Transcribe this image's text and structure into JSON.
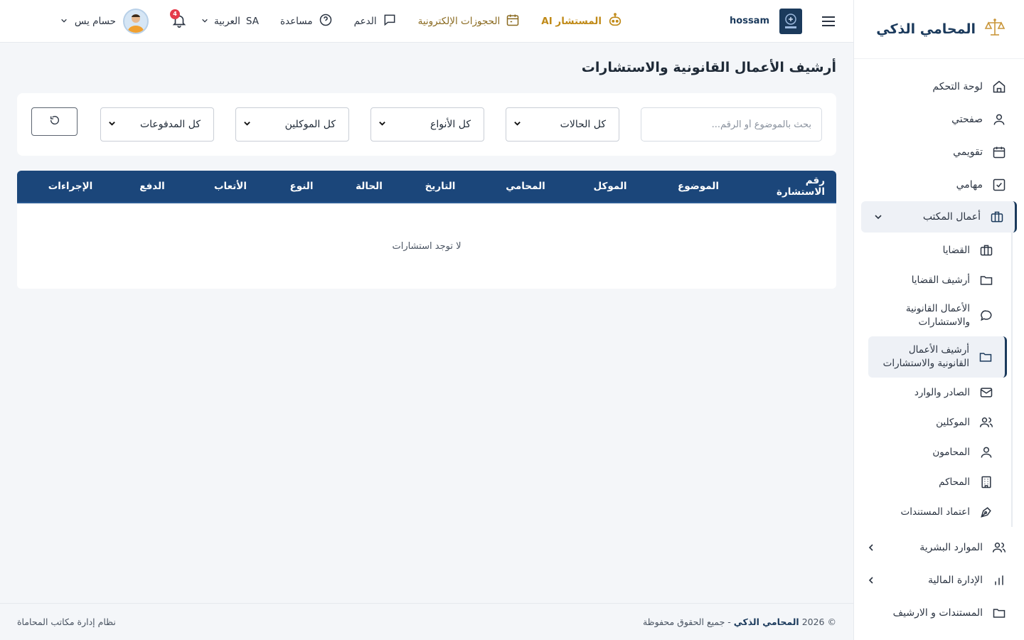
{
  "brand": {
    "name": "المحامي الذكي"
  },
  "topbar": {
    "username": "hossam",
    "ai_label": "المستشار AI",
    "booking_label": "الحجوزات الإلكترونية",
    "support_label": "الدعم",
    "help_label": "مساعدة",
    "lang_code": "SA",
    "lang_label": "العربية",
    "notification_count": "4",
    "profile_name": "حسام يس"
  },
  "sidebar": {
    "items": [
      {
        "label": "لوحة التحكم",
        "icon": "home-icon"
      },
      {
        "label": "صفحتي",
        "icon": "user-icon"
      },
      {
        "label": "تقويمي",
        "icon": "calendar-icon"
      },
      {
        "label": "مهامي",
        "icon": "checkbox-icon"
      }
    ],
    "office": {
      "label": "أعمال المكتب",
      "sub": [
        {
          "label": "القضايا"
        },
        {
          "label": "أرشيف القضايا"
        },
        {
          "label": "الأعمال القانونية والاستشارات"
        },
        {
          "label": "أرشيف الأعمال القانونية والاستشارات"
        },
        {
          "label": "الصادر والوارد"
        },
        {
          "label": "الموكلين"
        },
        {
          "label": "المحامون"
        },
        {
          "label": "المحاكم"
        },
        {
          "label": "اعتماد المستندات"
        }
      ]
    },
    "lower": [
      {
        "label": "الموارد البشرية"
      },
      {
        "label": "الإدارة المالية"
      },
      {
        "label": "المستندات و الارشيف"
      }
    ]
  },
  "main": {
    "title": "أرشيف الأعمال القانونية والاستشارات",
    "search_placeholder": "بحث بالموضوع أو الرقم...",
    "filters": {
      "status": "كل الحالات",
      "types": "كل الأنواع",
      "clients": "كل الموكلين",
      "payments": "كل المدفوعات"
    },
    "table": {
      "headers": [
        "رقم الاستشارة",
        "الموضوع",
        "الموكل",
        "المحامي",
        "التاريخ",
        "الحالة",
        "النوع",
        "الأتعاب",
        "الدفع",
        "الإجراءات"
      ],
      "empty": "لا توجد استشارات"
    }
  },
  "footer": {
    "copyright": "© 2026",
    "brand": "المحامي الذكي",
    "rights": "- جميع الحقوق محفوظة",
    "system": "نظام إدارة مكاتب المحاماة"
  }
}
